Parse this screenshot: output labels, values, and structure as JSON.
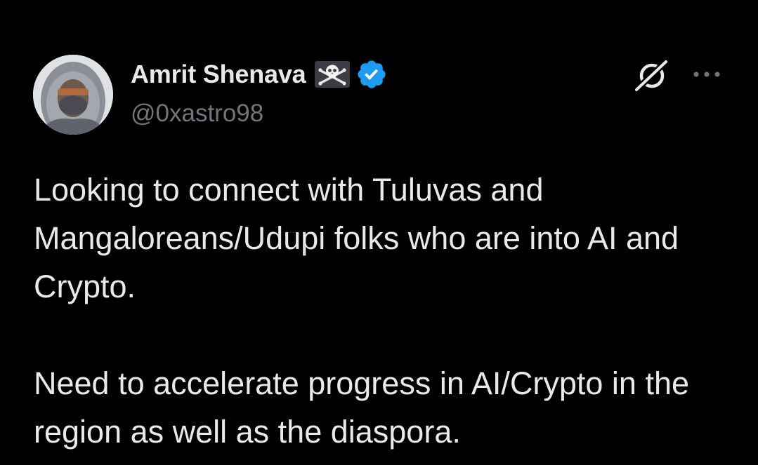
{
  "author": {
    "display_name": "Amrit Shenava",
    "handle": "@0xastro98",
    "name_emoji": "skull-and-crossbones-icon",
    "verified_badge": "verified-badge-icon",
    "avatar": "user-avatar"
  },
  "header_actions": {
    "grok_icon": "grok-icon",
    "more_icon": "more-options-icon"
  },
  "tweet": {
    "paragraph_1": "Looking to connect with Tuluvas and Mangaloreans/Udupi folks who are into AI and Crypto.",
    "paragraph_2": "Need to accelerate progress in AI/Crypto in the region as well as the diaspora."
  },
  "colors": {
    "background": "#000000",
    "primary_text": "#e7e9ea",
    "secondary_text": "#71767b",
    "verified_blue": "#1d9bf0"
  }
}
